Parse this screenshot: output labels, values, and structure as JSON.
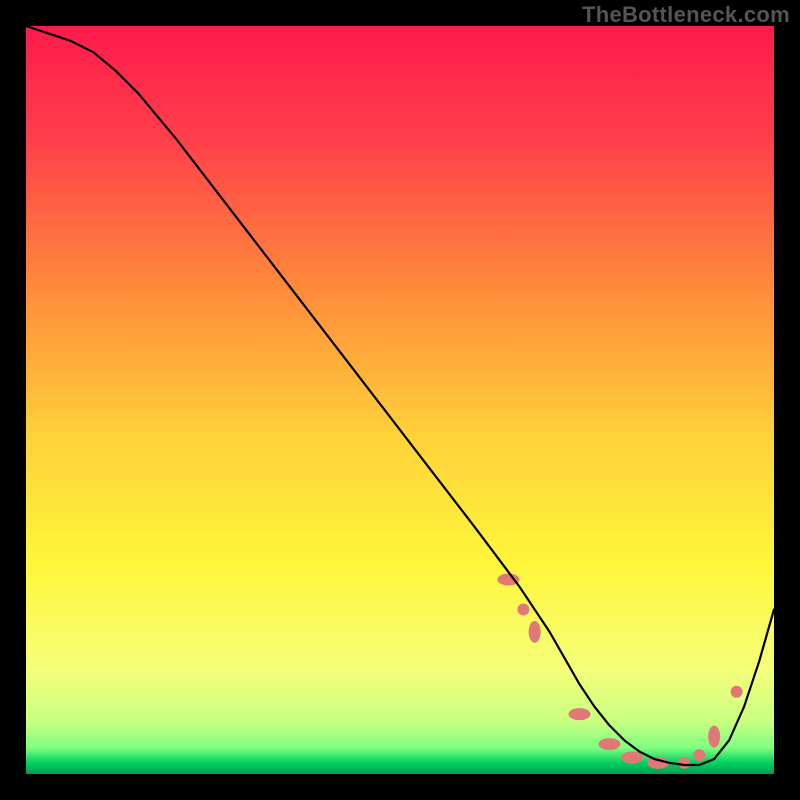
{
  "watermark": "TheBottleneck.com",
  "chart_data": {
    "type": "line",
    "xlabel": "",
    "ylabel": "",
    "xlim": [
      0,
      100
    ],
    "ylim": [
      0,
      100
    ],
    "gradient_stops": [
      {
        "offset": 0.0,
        "color": "#ff1a4b"
      },
      {
        "offset": 0.15,
        "color": "#ff3f4a"
      },
      {
        "offset": 0.35,
        "color": "#ff8a3a"
      },
      {
        "offset": 0.55,
        "color": "#ffd23a"
      },
      {
        "offset": 0.72,
        "color": "#fff63a"
      },
      {
        "offset": 0.86,
        "color": "#f5ff7a"
      },
      {
        "offset": 0.93,
        "color": "#c8ff80"
      },
      {
        "offset": 0.965,
        "color": "#80ff80"
      },
      {
        "offset": 0.985,
        "color": "#00d060"
      },
      {
        "offset": 1.0,
        "color": "#00a050"
      }
    ],
    "x": [
      0,
      3,
      6,
      9,
      12,
      15,
      20,
      25,
      30,
      35,
      40,
      45,
      50,
      55,
      60,
      63,
      66,
      68,
      70,
      72,
      74,
      76,
      78,
      80,
      82,
      84,
      86,
      88,
      90,
      92,
      94,
      96,
      98,
      100
    ],
    "values": [
      100,
      99,
      98,
      96.5,
      94,
      91,
      85,
      78.5,
      72,
      65.5,
      59,
      52.5,
      46,
      39.5,
      33,
      29,
      25,
      22,
      19,
      15.5,
      12,
      9,
      6.5,
      4.5,
      3,
      2,
      1.5,
      1.2,
      1.2,
      2,
      4.5,
      9,
      15,
      22
    ],
    "markers": [
      {
        "x": 64.5,
        "y": 26,
        "kind": "oval"
      },
      {
        "x": 66.5,
        "y": 22,
        "kind": "dot"
      },
      {
        "x": 68,
        "y": 19,
        "kind": "oval_vert"
      },
      {
        "x": 74,
        "y": 8,
        "kind": "oval"
      },
      {
        "x": 78,
        "y": 4,
        "kind": "oval"
      },
      {
        "x": 81,
        "y": 2.2,
        "kind": "oval"
      },
      {
        "x": 84.5,
        "y": 1.5,
        "kind": "oval"
      },
      {
        "x": 88,
        "y": 1.5,
        "kind": "dot"
      },
      {
        "x": 90,
        "y": 2.5,
        "kind": "dot"
      },
      {
        "x": 92,
        "y": 5,
        "kind": "oval_vert"
      },
      {
        "x": 95,
        "y": 11,
        "kind": "dot"
      }
    ]
  }
}
